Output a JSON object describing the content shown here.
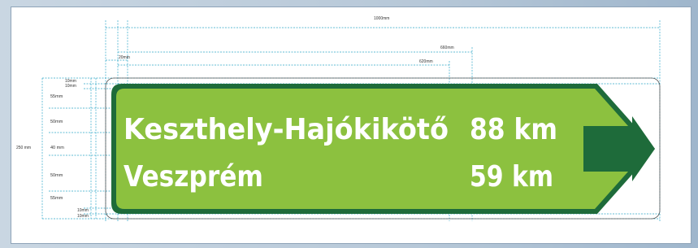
{
  "sign": {
    "destinations": [
      {
        "name": "Keszthely-Hajókikötő",
        "distance": "88 km"
      },
      {
        "name": "Veszprém",
        "distance": "59 km"
      }
    ]
  },
  "dimensions": {
    "total_width": "1000mm",
    "width_660": "660mm",
    "width_620": "620mm",
    "width_20": "20mm",
    "total_height": "250 mm",
    "rows": [
      "10mm",
      "10mm",
      "55mm",
      "50mm",
      "40 mm",
      "50mm",
      "55mm",
      "10mm",
      "10mm"
    ]
  },
  "colors": {
    "sign_green": "#8cc13f",
    "border_dark_green": "#1e6b3a",
    "arrow_block": "#1e6b3a",
    "dim_line": "#2fa6c8"
  }
}
